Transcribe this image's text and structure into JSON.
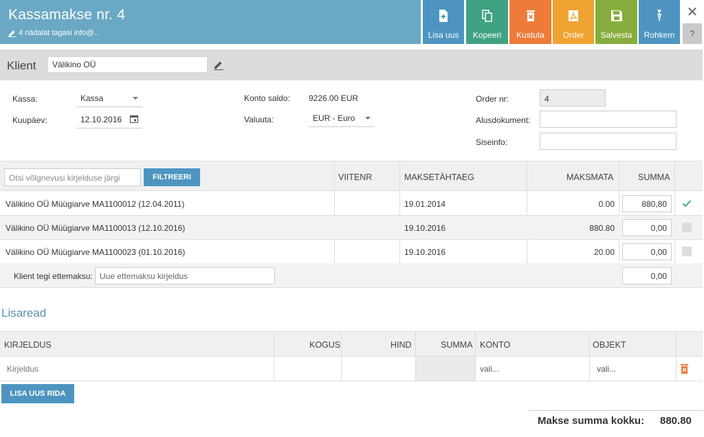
{
  "header": {
    "title": "Kassamakse nr. 4",
    "subtitle": "4 nädalat tagasi info@.."
  },
  "toolbar": {
    "lisa_uus": "Lisa uus",
    "kopeeri": "Kopeeri",
    "kustuta": "Kustuta",
    "order": "Order",
    "salvesta": "Salvesta",
    "rohkem": "Rohkem",
    "help": "?",
    "close": "✕"
  },
  "klient": {
    "label": "Klient",
    "value": "Välikino OÜ"
  },
  "form": {
    "kassa_label": "Kassa:",
    "kassa_value": "Kassa",
    "kuupaev_label": "Kuupäev:",
    "kuupaev_value": "12.10.2016",
    "konto_saldo_label": "Konto saldo:",
    "konto_saldo_value": "9226.00 EUR",
    "valuuta_label": "Valuuta:",
    "valuuta_value": "EUR - Euro",
    "order_nr_label": "Order nr:",
    "order_nr_value": "4",
    "alusdokument_label": "Alusdokument:",
    "alusdokument_value": "",
    "siseinfo_label": "Siseinfo:",
    "siseinfo_value": ""
  },
  "debts": {
    "search_placeholder": "Otsi võlgnevusi kirjelduse järgi",
    "filter_button": "FILTREERI",
    "columns": {
      "viitenr": "VIITENR",
      "maksetahtaeg": "MAKSETÄHTAEG",
      "maksmata": "MAKSMATA",
      "summa": "SUMMA"
    },
    "rows": [
      {
        "desc": "Välikino OÜ Müügiarve MA1100012 (12.04.2011)",
        "viitenr": "",
        "due": "19.01.2014",
        "unpaid": "0.00",
        "sum": "880,80",
        "checked": true
      },
      {
        "desc": "Välikino OÜ Müügiarve MA1100013 (12.10.2016)",
        "viitenr": "",
        "due": "19.10.2016",
        "unpaid": "880.80",
        "sum": "0,00",
        "checked": false
      },
      {
        "desc": "Välikino OÜ Müügiarve MA1100023 (01.10.2016)",
        "viitenr": "",
        "due": "19.10.2016",
        "unpaid": "20.00",
        "sum": "0,00",
        "checked": false
      }
    ],
    "prepayment_label": "Klient tegi ettemaksu:",
    "prepayment_placeholder": "Uue ettemaksu kirjeldus",
    "prepayment_sum": "0,00"
  },
  "extra": {
    "title": "Lisaread",
    "columns": {
      "kirjeldus": "KIRJELDUS",
      "kogus": "KOGUS",
      "hind": "HIND",
      "summa": "SUMMA",
      "konto": "KONTO",
      "objekt": "OBJEKT"
    },
    "row": {
      "kirjeldus_placeholder": "Kirjeldus",
      "konto": "vali...",
      "objekt": "vali..."
    },
    "add_button": "LISA UUS RIDA"
  },
  "total": {
    "label": "Makse summa kokku:",
    "value": "880.80"
  },
  "colors": {
    "header": "#6aa8c4",
    "blue": "#4d95c0",
    "green": "#3fa282",
    "orange": "#ee7b3a",
    "amber": "#f0a331",
    "lime": "#87ad3e"
  }
}
